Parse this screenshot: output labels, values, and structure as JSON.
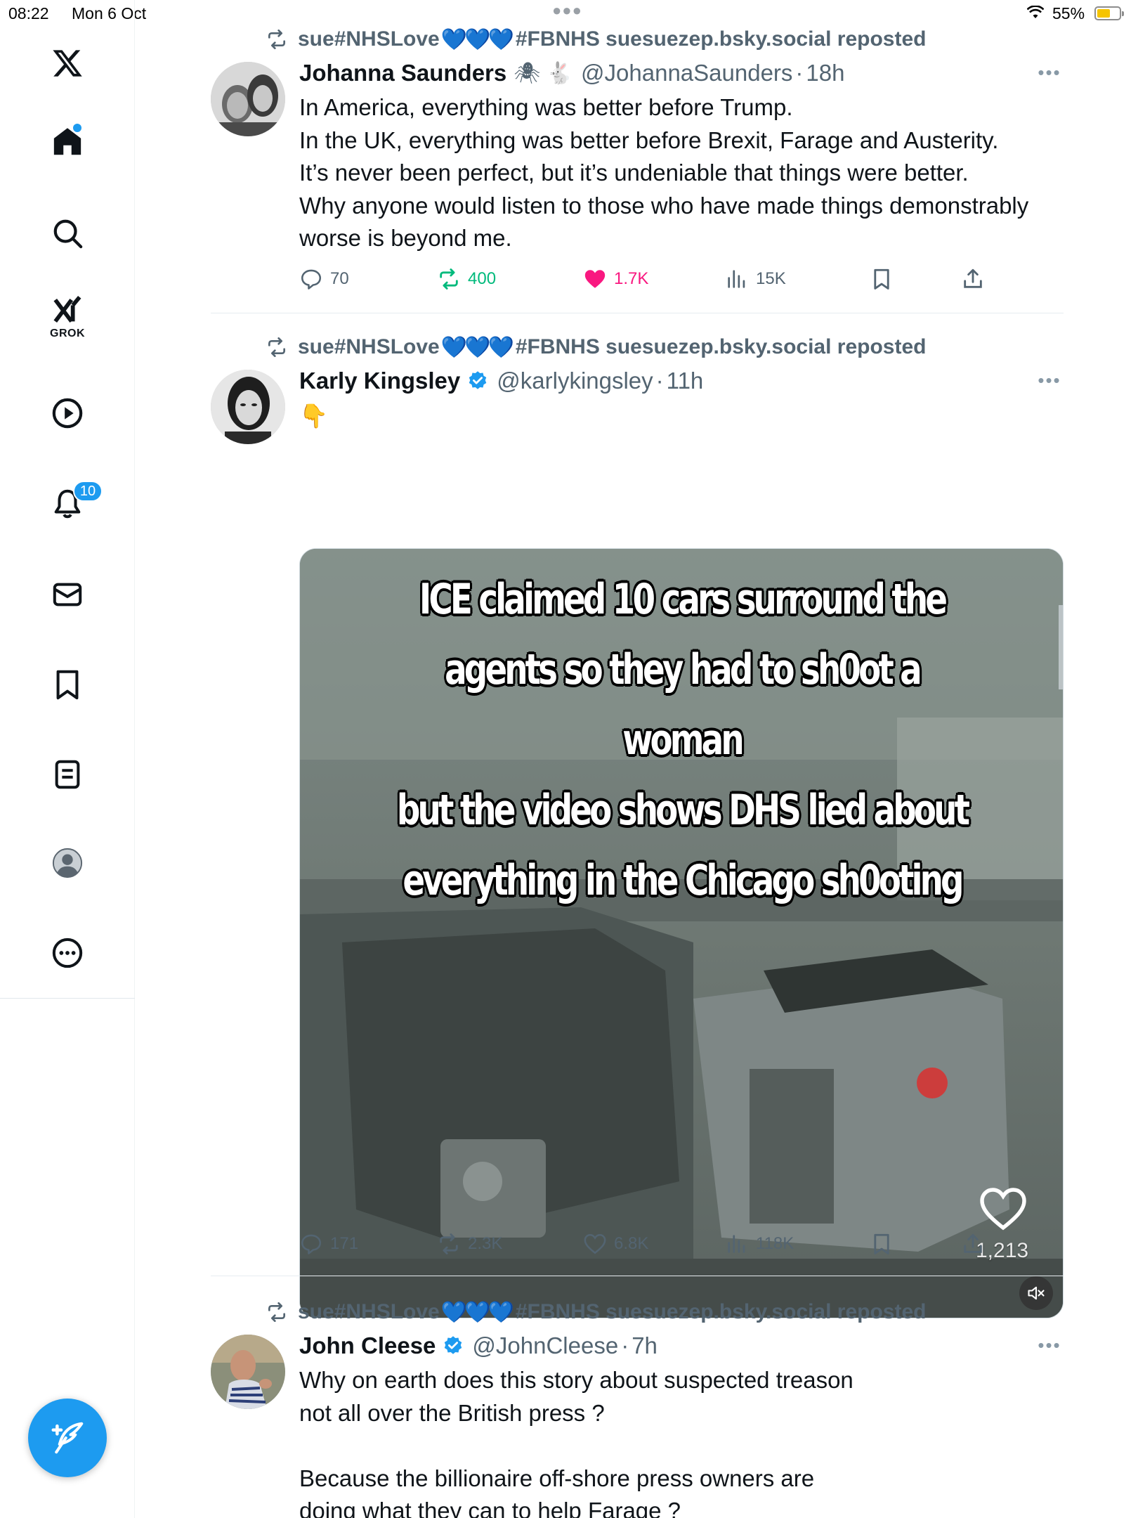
{
  "status_bar": {
    "time": "08:22",
    "date": "Mon 6 Oct",
    "battery_percent": "55%",
    "battery_level": 0.55
  },
  "sidebar": {
    "logo": "x-logo-icon",
    "items": [
      {
        "name": "home",
        "icon": "home-icon",
        "active": true
      },
      {
        "name": "explore",
        "icon": "search-icon"
      },
      {
        "name": "grok",
        "icon": "grok-icon",
        "label": "GROK"
      },
      {
        "name": "video",
        "icon": "play-icon"
      },
      {
        "name": "notifications",
        "icon": "bell-icon",
        "badge": "10"
      },
      {
        "name": "messages",
        "icon": "mail-icon"
      },
      {
        "name": "bookmarks",
        "icon": "bookmark-icon"
      },
      {
        "name": "lists",
        "icon": "lists-icon"
      },
      {
        "name": "profile",
        "icon": "profile-icon"
      },
      {
        "name": "more",
        "icon": "more-icon"
      }
    ],
    "compose_icon": "compose-post-icon"
  },
  "accent_color": "#1d9bf0",
  "posts": [
    {
      "repost_by_pre": "sue#NHSLove",
      "repost_hearts": "💙💙💙",
      "repost_by_post": "#FBNHS suesuezep.bsky.social reposted",
      "author": "Johanna Saunders",
      "author_emoji": "🕷 🐇",
      "handle": "@JohannaSaunders",
      "time": "18h",
      "text": "In America, everything was better before Trump.\nIn the UK, everything was better before Brexit, Farage and Austerity.\nIt’s never been perfect, but it’s undeniable that things were better.\nWhy anyone would listen to those who have made things demonstrably worse is beyond me.",
      "replies": "70",
      "reposts": "400",
      "likes": "1.7K",
      "views": "15K"
    },
    {
      "repost_by_pre": "sue#NHSLove",
      "repost_hearts": "💙💙💙",
      "repost_by_post": "#FBNHS suesuezep.bsky.social reposted",
      "author": "Karly Kingsley",
      "handle": "@karlykingsley",
      "time": "11h",
      "text": "👇",
      "media_text_lines": [
        "ICE claimed 10 cars surround the",
        "agents so they had to sh0ot a woman",
        "but the video shows DHS lied about",
        "everything in the Chicago sh0oting"
      ],
      "media_like_count": "1,213",
      "replies": "171",
      "reposts": "2.3K",
      "likes": "6.8K",
      "views": "118K"
    },
    {
      "repost_by_pre": "sue#NHSLove",
      "repost_hearts": "💙💙💙",
      "repost_by_post": "#FBNHS suesuezep.bsky.social reposted",
      "author": "John Cleese",
      "handle": "@JohnCleese",
      "time": "7h",
      "text": "Why on earth does this story about suspected treason\nnot all over the British press ?\n\nBecause the billionaire off-shore press owners are\ndoing what they can to help Farage ?"
    }
  ]
}
